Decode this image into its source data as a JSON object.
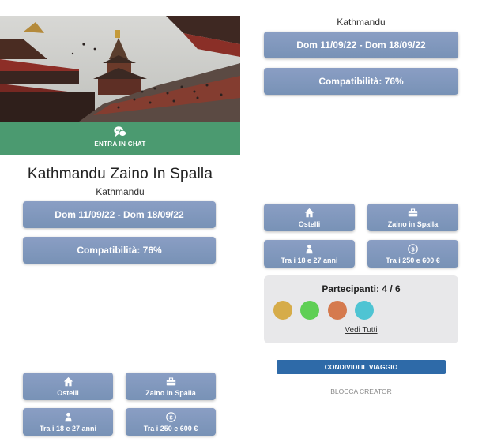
{
  "hero": {
    "chat_label": "ENTRA IN CHAT"
  },
  "trip": {
    "title": "Kathmandu Zaino In Spalla",
    "city": "Kathmandu",
    "dates": "Dom 11/09/22 - Dom 18/09/22",
    "compatibility": "Compatibilità: 76%"
  },
  "features": [
    {
      "label": "Ostelli",
      "icon": "house-icon"
    },
    {
      "label": "Zaino in Spalla",
      "icon": "suitcase-icon"
    },
    {
      "label": "Tra i 18 e 27 anni",
      "icon": "person-icon"
    },
    {
      "label": "Tra i 250 e 600 €",
      "icon": "coin-icon"
    }
  ],
  "participants": {
    "title": "Partecipanti: 4 / 6",
    "avatar_colors": [
      "#d6ac4a",
      "#5fcf55",
      "#d57a4e",
      "#4fc4d3"
    ],
    "see_all": "Vedi Tutti"
  },
  "actions": {
    "share": "CONDIVIDI IL VIAGGIO",
    "block": "BLOCCA CREATOR"
  }
}
